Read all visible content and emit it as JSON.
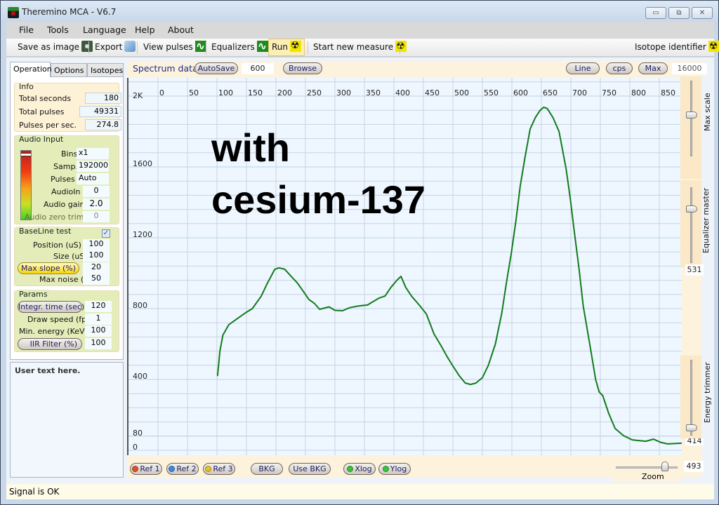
{
  "window": {
    "title": "Theremino MCA - V6.7",
    "controls": {
      "minimize": "▭",
      "maximize": "⧉",
      "close": "✕"
    }
  },
  "menu": [
    "File",
    "Tools",
    "Language",
    "Help",
    "About"
  ],
  "toolbar": {
    "save_image": "Save as image",
    "export": "Export",
    "view_pulses": "View pulses",
    "equalizers": "Equalizers",
    "run": "Run",
    "start_new": "Start new measure",
    "isotope_identifier": "Isotope identifier",
    "icons": {
      "save_image": "camera-icon",
      "export": "scroll-icon",
      "view_pulses": "wave-icon",
      "equalizers": "wave-icon",
      "run": "radiation-icon",
      "start_new": "radiation-icon",
      "isotope_identifier": "radiation-icon"
    }
  },
  "tabs": [
    {
      "label": "Operation",
      "active": true
    },
    {
      "label": "Options",
      "active": false
    },
    {
      "label": "Isotopes",
      "active": false
    }
  ],
  "info": {
    "title": "Info",
    "rows": [
      {
        "label": "Total seconds",
        "value": "180"
      },
      {
        "label": "Total pulses",
        "value": "49331"
      },
      {
        "label": "Pulses per sec.",
        "value": "274.8"
      }
    ]
  },
  "audio": {
    "title": "Audio Input",
    "bins_label": "Bins",
    "bins": "x1",
    "samp_label": "Samp.",
    "samp": "192000",
    "pulses_label": "Pulses",
    "pulses": "Auto",
    "audioin_label": "AudioIn",
    "audioin": "0",
    "gain_label": "Audio gain",
    "gain": "2.0",
    "zero_trim_label": "Audio zero trim",
    "zero_trim": "0"
  },
  "baseline": {
    "title": "BaseLine test",
    "checked": "✓",
    "position_label": "Position (uS)",
    "position": "100",
    "size_label": "Size (uS)",
    "size": "100",
    "max_slope_label": "Max slope (%)",
    "max_slope": "20",
    "max_noise_label": "Max noise (%)",
    "max_noise": "50"
  },
  "params": {
    "title": "Params",
    "integr_label": "Integr. time (sec)",
    "integr": "120",
    "draw_speed_label": "Draw speed (fps)",
    "draw_speed": "1",
    "min_energy_label": "Min. energy (KeV)",
    "min_energy": "100",
    "iir_label": "IIR Filter (%)",
    "iir": "100"
  },
  "user_text": "User text here.",
  "spectrum": {
    "title": "Spectrum data",
    "autosave": "AutoSave",
    "autosave_value": "600",
    "browse": "Browse",
    "line": "Line",
    "cps": "cps",
    "max": "Max",
    "max_scale_value": "16000",
    "overlay_line1": "with",
    "overlay_line2": "cesium-137"
  },
  "sliders": {
    "max_scale_label": "Max scale",
    "equalizer_master_label": "Equalizer master",
    "equalizer_master_value": "531",
    "energy_trimmer_label": "Energy trimmer",
    "energy_trimmer_value": "414",
    "zoom_label": "Zoom",
    "zoom_value": "493",
    "max_scale_fraction": 0.42,
    "equalizer_master_fraction": 0.25,
    "energy_trimmer_fraction": 0.88,
    "zoom_fraction": 0.77
  },
  "bottom_buttons": [
    {
      "label": "Ref 1",
      "dot": "#e2502a"
    },
    {
      "label": "Ref 2",
      "dot": "#3a8ae0"
    },
    {
      "label": "Ref 3",
      "dot": "#e8c21c"
    },
    {
      "label": "BKG",
      "dot": null
    },
    {
      "label": "Use BKG",
      "dot": null
    },
    {
      "label": "Xlog",
      "dot": "#3cc23c"
    },
    {
      "label": "Ylog",
      "dot": "#3cc23c"
    }
  ],
  "status": "Signal is OK",
  "chart_data": {
    "type": "line",
    "title": "",
    "xlabel": "",
    "ylabel": "",
    "xlim": [
      0,
      912
    ],
    "ylim": [
      0,
      2000
    ],
    "x_ticks": [
      "0",
      "50",
      "100",
      "150",
      "200",
      "250",
      "300",
      "350",
      "400",
      "450",
      "500",
      "550",
      "600",
      "650",
      "700",
      "750",
      "800",
      "850"
    ],
    "y_ticks": [
      {
        "value": 2000,
        "label": "2K"
      },
      {
        "value": 1600,
        "label": "1600"
      },
      {
        "value": 1200,
        "label": "1200"
      },
      {
        "value": 800,
        "label": "800"
      },
      {
        "value": 400,
        "label": "400"
      },
      {
        "value": 80,
        "label": "80"
      },
      {
        "value": 0,
        "label": "0"
      }
    ],
    "grid": true,
    "line_color": "#137a1c",
    "series": [
      {
        "name": "spectrum",
        "x": [
          101,
          105,
          110,
          120,
          135,
          150,
          160,
          175,
          185,
          198,
          205,
          215,
          225,
          236,
          246,
          256,
          265,
          274,
          290,
          300,
          313,
          325,
          340,
          355,
          365,
          375,
          385,
          395,
          405,
          412,
          420,
          430,
          444,
          455,
          468,
          480,
          490,
          501,
          511,
          521,
          530,
          539,
          550,
          560,
          572,
          583,
          591,
          599,
          607,
          614,
          622,
          631,
          640,
          648,
          654,
          660,
          670,
          680,
          692,
          699,
          706,
          714,
          721,
          732,
          742,
          748,
          754,
          764,
          775,
          789,
          804,
          815,
          827,
          840,
          852,
          864,
          876,
          888
        ],
        "values": [
          420,
          560,
          650,
          709,
          745,
          780,
          800,
          870,
          940,
          1022,
          1030,
          1022,
          985,
          946,
          900,
          851,
          830,
          796,
          810,
          790,
          788,
          805,
          815,
          820,
          840,
          860,
          871,
          920,
          960,
          982,
          920,
          870,
          816,
          770,
          657,
          590,
          530,
          471,
          420,
          380,
          372,
          380,
          410,
          479,
          600,
          776,
          950,
          1113,
          1300,
          1489,
          1650,
          1814,
          1880,
          1920,
          1937,
          1930,
          1877,
          1800,
          1588,
          1420,
          1232,
          1020,
          816,
          600,
          400,
          330,
          309,
          210,
          123,
          83,
          59,
          55,
          51,
          63,
          45,
          36,
          38,
          40
        ]
      }
    ]
  }
}
